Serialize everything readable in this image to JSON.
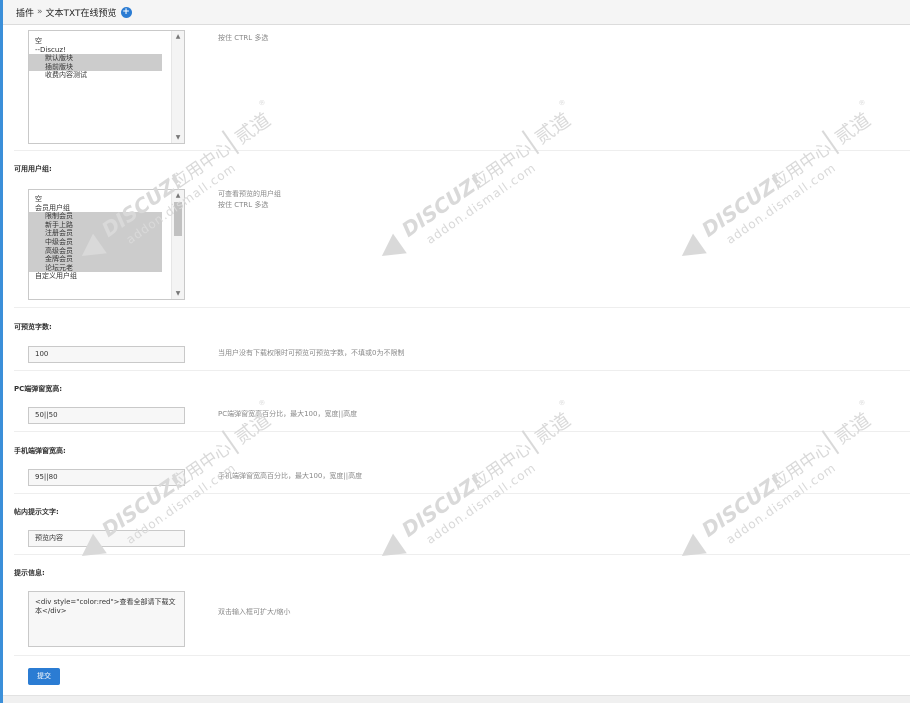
{
  "header": {
    "crumb_root": "插件",
    "crumb_sep": "»",
    "crumb_page": "文本TXT在线预览",
    "info_icon": "info-circle-icon"
  },
  "boards": {
    "hint": "按住 CTRL 多选",
    "options": [
      {
        "label": "空",
        "selected": false,
        "indent": false
      },
      {
        "label": "--Discuz!",
        "selected": false,
        "indent": false
      },
      {
        "label": "默认版块",
        "selected": true,
        "indent": true
      },
      {
        "label": "插前版块",
        "selected": true,
        "indent": true
      },
      {
        "label": "收费内容测试",
        "selected": false,
        "indent": true
      }
    ]
  },
  "usergroups": {
    "label": "可用用户组:",
    "hint_line1": "可查看预览的用户组",
    "hint_line2": "按住 CTRL 多选",
    "options": [
      {
        "label": "空",
        "selected": false,
        "indent": false
      },
      {
        "label": "会员用户组",
        "selected": false,
        "indent": false
      },
      {
        "label": "限制会员",
        "selected": true,
        "indent": true
      },
      {
        "label": "新手上路",
        "selected": true,
        "indent": true
      },
      {
        "label": "注册会员",
        "selected": true,
        "indent": true
      },
      {
        "label": "中级会员",
        "selected": true,
        "indent": true
      },
      {
        "label": "高级会员",
        "selected": true,
        "indent": true
      },
      {
        "label": "金牌会员",
        "selected": true,
        "indent": true
      },
      {
        "label": "论坛元老",
        "selected": true,
        "indent": true
      },
      {
        "label": "自定义用户组",
        "selected": false,
        "indent": false
      }
    ]
  },
  "preview_chars": {
    "label": "可预览字数:",
    "value": "100",
    "hint": "当用户没有下载权限时可预览可预览字数，不填或0为不限制"
  },
  "pc_popup": {
    "label": "PC端弹窗宽高:",
    "value": "50||50",
    "hint": "PC端弹窗宽高百分比，最大100，宽度||高度"
  },
  "mobile_popup": {
    "label": "手机端弹窗宽高:",
    "value": "95||80",
    "hint": "手机端弹窗宽高百分比，最大100，宽度||高度"
  },
  "inline_tip": {
    "label": "帖内提示文字:",
    "value": "预览内容"
  },
  "tip_info": {
    "label": "提示信息:",
    "value": "<div style=\"color:red\">查看全部请下载文本</div>",
    "hint": "双击输入框可扩大/缩小"
  },
  "submit_label": "提交",
  "watermark": {
    "brand": "DISCUZ!",
    "cn": "应用中心",
    "site": "addon.dismall.com",
    "sign": "贰道",
    "reg": "®"
  }
}
